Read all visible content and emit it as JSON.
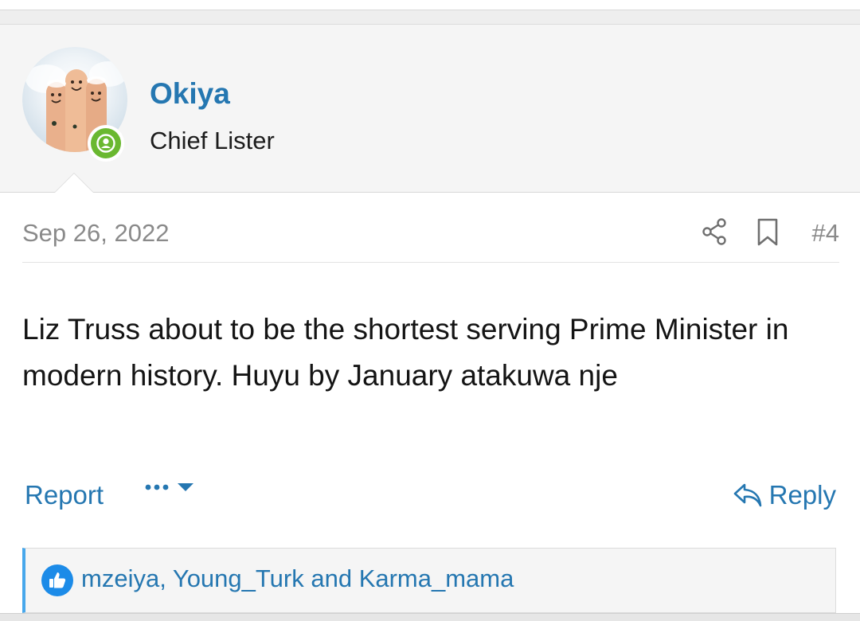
{
  "post": {
    "author": {
      "username": "Okiya",
      "title": "Chief Lister",
      "avatar_icon": "avatar-fingers-illustration",
      "online_status_icon": "user-online-icon"
    },
    "date": "Sep 26, 2022",
    "post_number": "#4",
    "icons": {
      "share": "share-icon",
      "bookmark": "bookmark-icon"
    },
    "body": "Liz Truss about to be the shortest serving Prime Minister in modern history. Huyu by January atakuwa nje",
    "actions": {
      "report_label": "Report",
      "reply_label": "Reply"
    },
    "reactions": {
      "icon": "like-icon",
      "names": "mzeiya, Young_Turk and Karma_mama"
    }
  },
  "colors": {
    "link": "#2577b1",
    "online": "#6ab830",
    "like": "#1c8be8",
    "reaction_accent": "#47a7eb"
  }
}
